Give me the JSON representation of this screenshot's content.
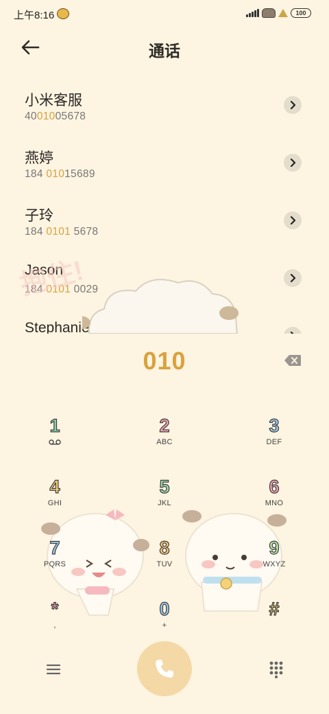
{
  "status_bar": {
    "time": "上午8:16",
    "battery": "100"
  },
  "header": {
    "title": "通话",
    "back_icon": "arrow-left-icon"
  },
  "contacts": [
    {
      "name": "小米客服",
      "number_parts": [
        "40",
        "010",
        "05678"
      ]
    },
    {
      "name": "燕婷",
      "number_parts": [
        "184 ",
        "010",
        "15689"
      ]
    },
    {
      "name": "子玲",
      "number_parts": [
        "184 ",
        "0101",
        " 5678"
      ]
    },
    {
      "name": "Jason",
      "number_parts": [
        "184 ",
        "0101",
        " 0029"
      ]
    },
    {
      "name": "Stephanie",
      "number_parts": [
        "",
        "",
        ""
      ]
    }
  ],
  "watermark": "抱住!",
  "dialed_number": "010",
  "keypad": [
    {
      "digit": "1",
      "letters": "",
      "color": "#8fd3b0",
      "icon": "voicemail-icon"
    },
    {
      "digit": "2",
      "letters": "ABC",
      "color": "#f2a3b3"
    },
    {
      "digit": "3",
      "letters": "DEF",
      "color": "#9fcbe8"
    },
    {
      "digit": "4",
      "letters": "GHI",
      "color": "#f4d27a"
    },
    {
      "digit": "5",
      "letters": "JKL",
      "color": "#9ed9b3"
    },
    {
      "digit": "6",
      "letters": "MNO",
      "color": "#f2a3b3"
    },
    {
      "digit": "7",
      "letters": "PQRS",
      "color": "#9fcbe8"
    },
    {
      "digit": "8",
      "letters": "TUV",
      "color": "#f4c67a"
    },
    {
      "digit": "9",
      "letters": "WXYZ",
      "color": "#b8e3a8"
    },
    {
      "digit": "*",
      "letters": ",",
      "color": "#f2a3b3"
    },
    {
      "digit": "0",
      "letters": "+",
      "color": "#9fcbe8"
    },
    {
      "digit": "#",
      "letters": "",
      "color": "#f4d27a"
    }
  ],
  "colors": {
    "background": "#fdf4e1",
    "accent": "#d9a23e",
    "call_button": "#f4d9a6"
  }
}
